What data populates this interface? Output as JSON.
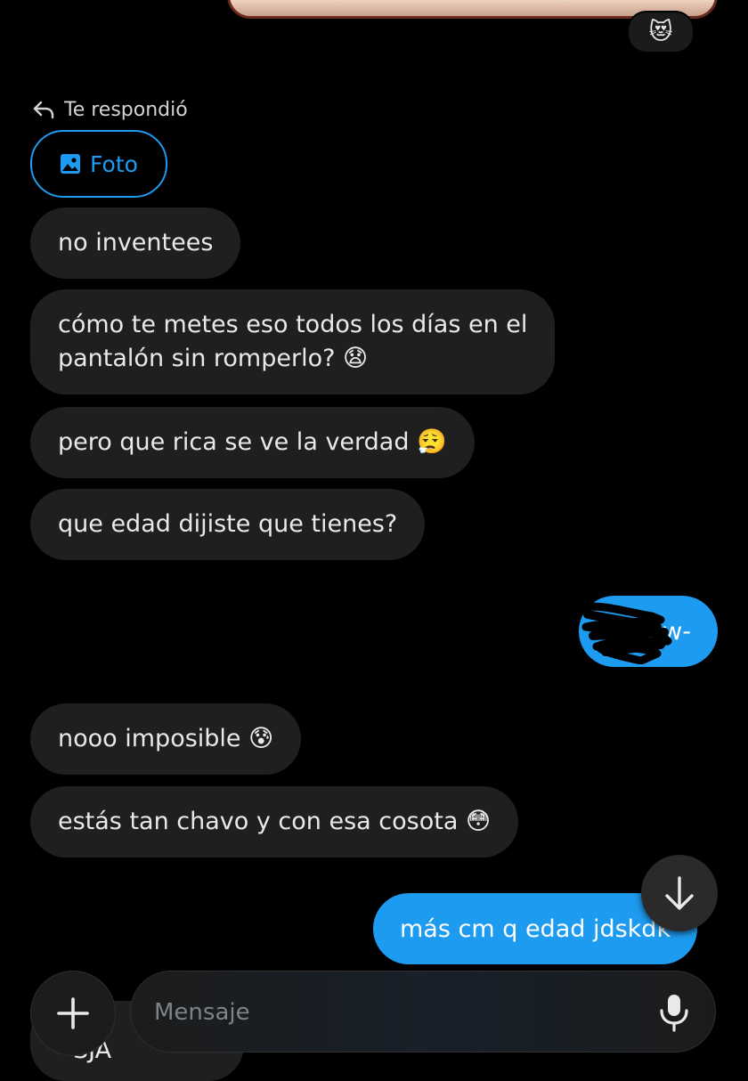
{
  "top": {
    "reaction_emoji": "😻"
  },
  "reply": {
    "label": "Te respondió",
    "attachment_label": "Foto"
  },
  "messages": [
    {
      "from": "them",
      "text": "no inventees"
    },
    {
      "from": "them",
      "lines": [
        "cómo te metes eso todos los días en el",
        "pantalón sin romperlo? 😧"
      ]
    },
    {
      "from": "them",
      "text": "pero que rica se ve la verdad 😮‍💨"
    },
    {
      "from": "them",
      "text": "que edad dijiste que tienes?"
    },
    {
      "from": "me",
      "text": "w-",
      "redacted": true
    },
    {
      "from": "them",
      "text": "nooo imposible 😰"
    },
    {
      "from": "them",
      "text": "estás tan chavo y con esa cosota 😳"
    },
    {
      "from": "me",
      "text": "más cm q edad jdskdk"
    },
    {
      "from": "them",
      "text": "SJA"
    }
  ],
  "composer": {
    "placeholder": "Mensaje"
  },
  "colors": {
    "accent": "#1d9bf0",
    "bubble_in": "#1f1f1f",
    "background": "#000000"
  },
  "icons": [
    "reply-arrow-icon",
    "image-icon",
    "arrow-down-icon",
    "plus-icon",
    "microphone-icon"
  ]
}
